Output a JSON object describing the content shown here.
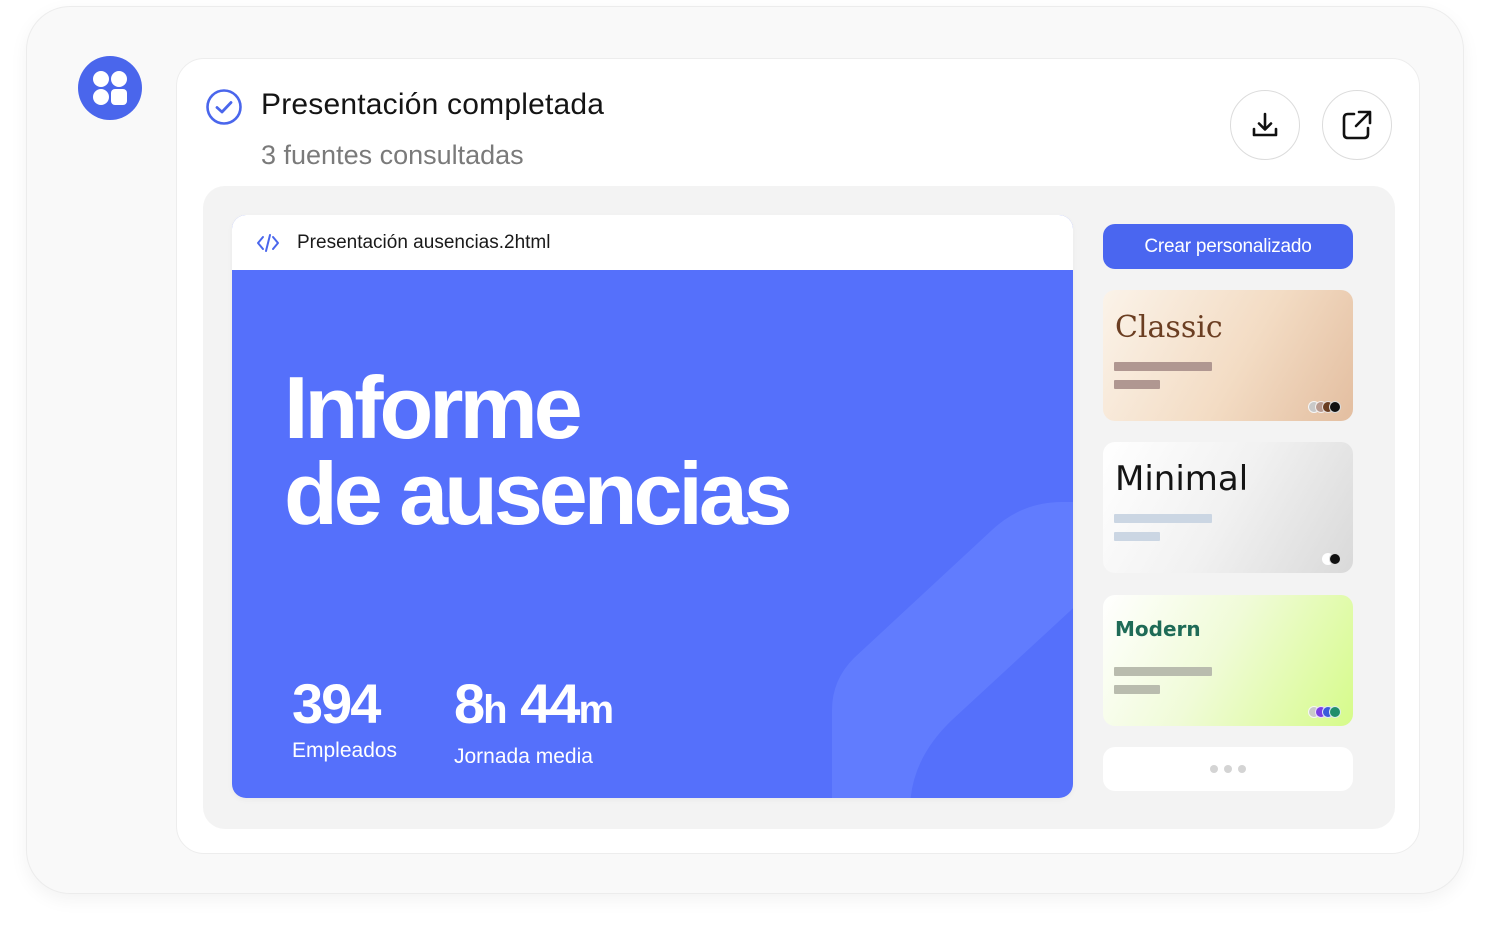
{
  "header": {
    "title": "Presentación completada",
    "subtitle": "3 fuentes consultadas"
  },
  "preview": {
    "file_name": "Presentación ausencias.2html",
    "heading_line1": "Informe",
    "heading_line2": "de ausencias",
    "stats": [
      {
        "value": "394",
        "label": "Empleados"
      },
      {
        "hours": "8",
        "hours_unit": "h",
        "minutes": "44",
        "minutes_unit": "m",
        "label": "Jornada media"
      }
    ]
  },
  "sidebar": {
    "create_label": "Crear personalizado",
    "themes": [
      {
        "name": "Classic",
        "swatches": [
          "#c9c9c9",
          "#b89a8f",
          "#6b3e22",
          "#111111"
        ]
      },
      {
        "name": "Minimal",
        "swatches": [
          "#ffffff",
          "#111111"
        ]
      },
      {
        "name": "Modern",
        "swatches": [
          "#c9c9c9",
          "#7b3fe4",
          "#3b5bdb",
          "#1f8f6b"
        ]
      }
    ]
  },
  "colors": {
    "brand": "#4a66ec",
    "slide_bg": "#5570fb"
  },
  "icons": {
    "logo": "app-grid-logo-icon",
    "status": "check-circle-icon",
    "download": "download-icon",
    "open": "external-link-icon",
    "file": "code-icon",
    "more": "ellipsis-icon"
  }
}
